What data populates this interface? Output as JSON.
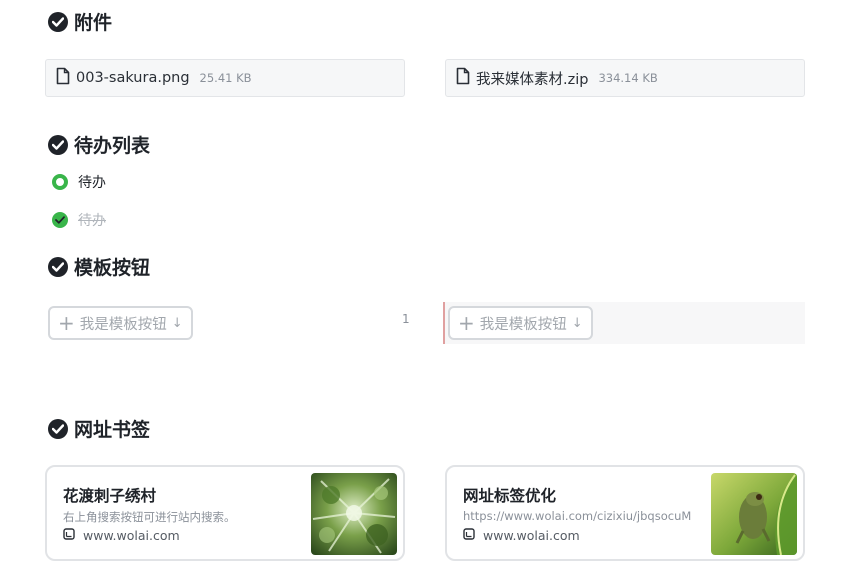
{
  "attachments": {
    "title": "附件",
    "files": [
      {
        "name": "003-sakura.png",
        "size": "25.41 KB"
      },
      {
        "name": "我来媒体素材.zip",
        "size": "334.14 KB"
      }
    ]
  },
  "todos": {
    "title": "待办列表",
    "items": [
      {
        "label": "待办",
        "done": false
      },
      {
        "label": "待办",
        "done": true
      }
    ]
  },
  "templates": {
    "title": "模板按钮",
    "buttons": [
      {
        "label": "我是模板按钮"
      },
      {
        "label": "我是模板按钮"
      }
    ],
    "counter": "1"
  },
  "bookmarks": {
    "title": "网址书签",
    "items": [
      {
        "title": "花渡刺子绣村",
        "desc": "右上角搜索按钮可进行站内搜索。",
        "site": "www.wolai.com"
      },
      {
        "title": "网址标签优化",
        "desc": "https://www.wolai.com/cizixiu/jbqsocuM",
        "site": "www.wolai.com"
      }
    ]
  },
  "colors": {
    "accent_green": "#39b54a",
    "dark": "#1f2329",
    "muted": "#8a9099"
  }
}
